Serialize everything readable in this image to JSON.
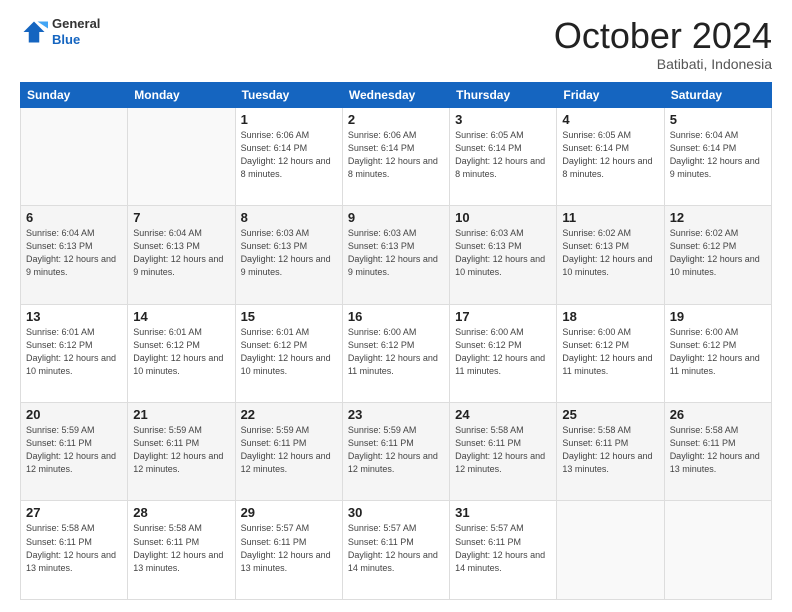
{
  "header": {
    "logo_general": "General",
    "logo_blue": "Blue",
    "month_title": "October 2024",
    "location": "Batibati, Indonesia"
  },
  "weekdays": [
    "Sunday",
    "Monday",
    "Tuesday",
    "Wednesday",
    "Thursday",
    "Friday",
    "Saturday"
  ],
  "weeks": [
    [
      {
        "day": "",
        "sunrise": "",
        "sunset": "",
        "daylight": "",
        "empty": true
      },
      {
        "day": "",
        "sunrise": "",
        "sunset": "",
        "daylight": "",
        "empty": true
      },
      {
        "day": "1",
        "sunrise": "Sunrise: 6:06 AM",
        "sunset": "Sunset: 6:14 PM",
        "daylight": "Daylight: 12 hours and 8 minutes."
      },
      {
        "day": "2",
        "sunrise": "Sunrise: 6:06 AM",
        "sunset": "Sunset: 6:14 PM",
        "daylight": "Daylight: 12 hours and 8 minutes."
      },
      {
        "day": "3",
        "sunrise": "Sunrise: 6:05 AM",
        "sunset": "Sunset: 6:14 PM",
        "daylight": "Daylight: 12 hours and 8 minutes."
      },
      {
        "day": "4",
        "sunrise": "Sunrise: 6:05 AM",
        "sunset": "Sunset: 6:14 PM",
        "daylight": "Daylight: 12 hours and 8 minutes."
      },
      {
        "day": "5",
        "sunrise": "Sunrise: 6:04 AM",
        "sunset": "Sunset: 6:14 PM",
        "daylight": "Daylight: 12 hours and 9 minutes."
      }
    ],
    [
      {
        "day": "6",
        "sunrise": "Sunrise: 6:04 AM",
        "sunset": "Sunset: 6:13 PM",
        "daylight": "Daylight: 12 hours and 9 minutes."
      },
      {
        "day": "7",
        "sunrise": "Sunrise: 6:04 AM",
        "sunset": "Sunset: 6:13 PM",
        "daylight": "Daylight: 12 hours and 9 minutes."
      },
      {
        "day": "8",
        "sunrise": "Sunrise: 6:03 AM",
        "sunset": "Sunset: 6:13 PM",
        "daylight": "Daylight: 12 hours and 9 minutes."
      },
      {
        "day": "9",
        "sunrise": "Sunrise: 6:03 AM",
        "sunset": "Sunset: 6:13 PM",
        "daylight": "Daylight: 12 hours and 9 minutes."
      },
      {
        "day": "10",
        "sunrise": "Sunrise: 6:03 AM",
        "sunset": "Sunset: 6:13 PM",
        "daylight": "Daylight: 12 hours and 10 minutes."
      },
      {
        "day": "11",
        "sunrise": "Sunrise: 6:02 AM",
        "sunset": "Sunset: 6:13 PM",
        "daylight": "Daylight: 12 hours and 10 minutes."
      },
      {
        "day": "12",
        "sunrise": "Sunrise: 6:02 AM",
        "sunset": "Sunset: 6:12 PM",
        "daylight": "Daylight: 12 hours and 10 minutes."
      }
    ],
    [
      {
        "day": "13",
        "sunrise": "Sunrise: 6:01 AM",
        "sunset": "Sunset: 6:12 PM",
        "daylight": "Daylight: 12 hours and 10 minutes."
      },
      {
        "day": "14",
        "sunrise": "Sunrise: 6:01 AM",
        "sunset": "Sunset: 6:12 PM",
        "daylight": "Daylight: 12 hours and 10 minutes."
      },
      {
        "day": "15",
        "sunrise": "Sunrise: 6:01 AM",
        "sunset": "Sunset: 6:12 PM",
        "daylight": "Daylight: 12 hours and 10 minutes."
      },
      {
        "day": "16",
        "sunrise": "Sunrise: 6:00 AM",
        "sunset": "Sunset: 6:12 PM",
        "daylight": "Daylight: 12 hours and 11 minutes."
      },
      {
        "day": "17",
        "sunrise": "Sunrise: 6:00 AM",
        "sunset": "Sunset: 6:12 PM",
        "daylight": "Daylight: 12 hours and 11 minutes."
      },
      {
        "day": "18",
        "sunrise": "Sunrise: 6:00 AM",
        "sunset": "Sunset: 6:12 PM",
        "daylight": "Daylight: 12 hours and 11 minutes."
      },
      {
        "day": "19",
        "sunrise": "Sunrise: 6:00 AM",
        "sunset": "Sunset: 6:12 PM",
        "daylight": "Daylight: 12 hours and 11 minutes."
      }
    ],
    [
      {
        "day": "20",
        "sunrise": "Sunrise: 5:59 AM",
        "sunset": "Sunset: 6:11 PM",
        "daylight": "Daylight: 12 hours and 12 minutes."
      },
      {
        "day": "21",
        "sunrise": "Sunrise: 5:59 AM",
        "sunset": "Sunset: 6:11 PM",
        "daylight": "Daylight: 12 hours and 12 minutes."
      },
      {
        "day": "22",
        "sunrise": "Sunrise: 5:59 AM",
        "sunset": "Sunset: 6:11 PM",
        "daylight": "Daylight: 12 hours and 12 minutes."
      },
      {
        "day": "23",
        "sunrise": "Sunrise: 5:59 AM",
        "sunset": "Sunset: 6:11 PM",
        "daylight": "Daylight: 12 hours and 12 minutes."
      },
      {
        "day": "24",
        "sunrise": "Sunrise: 5:58 AM",
        "sunset": "Sunset: 6:11 PM",
        "daylight": "Daylight: 12 hours and 12 minutes."
      },
      {
        "day": "25",
        "sunrise": "Sunrise: 5:58 AM",
        "sunset": "Sunset: 6:11 PM",
        "daylight": "Daylight: 12 hours and 13 minutes."
      },
      {
        "day": "26",
        "sunrise": "Sunrise: 5:58 AM",
        "sunset": "Sunset: 6:11 PM",
        "daylight": "Daylight: 12 hours and 13 minutes."
      }
    ],
    [
      {
        "day": "27",
        "sunrise": "Sunrise: 5:58 AM",
        "sunset": "Sunset: 6:11 PM",
        "daylight": "Daylight: 12 hours and 13 minutes."
      },
      {
        "day": "28",
        "sunrise": "Sunrise: 5:58 AM",
        "sunset": "Sunset: 6:11 PM",
        "daylight": "Daylight: 12 hours and 13 minutes."
      },
      {
        "day": "29",
        "sunrise": "Sunrise: 5:57 AM",
        "sunset": "Sunset: 6:11 PM",
        "daylight": "Daylight: 12 hours and 13 minutes."
      },
      {
        "day": "30",
        "sunrise": "Sunrise: 5:57 AM",
        "sunset": "Sunset: 6:11 PM",
        "daylight": "Daylight: 12 hours and 14 minutes."
      },
      {
        "day": "31",
        "sunrise": "Sunrise: 5:57 AM",
        "sunset": "Sunset: 6:11 PM",
        "daylight": "Daylight: 12 hours and 14 minutes."
      },
      {
        "day": "",
        "sunrise": "",
        "sunset": "",
        "daylight": "",
        "empty": true
      },
      {
        "day": "",
        "sunrise": "",
        "sunset": "",
        "daylight": "",
        "empty": true
      }
    ]
  ]
}
